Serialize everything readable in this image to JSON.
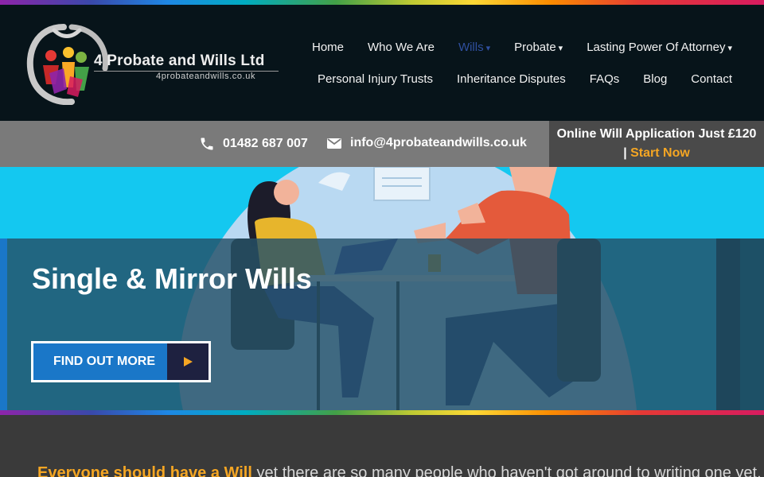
{
  "brand": {
    "name": "4 Probate and Wills Ltd",
    "url": "4probateandwills.co.uk",
    "colors": {
      "accent_orange": "#f5a623",
      "blue": "#1a77c8",
      "dark": "#07141a"
    }
  },
  "nav": {
    "row1": [
      {
        "label": "Home"
      },
      {
        "label": "Who We Are"
      },
      {
        "label": "Wills",
        "caret": "▾",
        "active": true
      },
      {
        "label": "Probate",
        "caret": "▾"
      },
      {
        "label": "Lasting Power Of Attorney",
        "caret": "▾"
      }
    ],
    "row2": [
      {
        "label": "Personal Injury Trusts"
      },
      {
        "label": "Inheritance Disputes"
      },
      {
        "label": "FAQs"
      },
      {
        "label": "Blog"
      },
      {
        "label": "Contact"
      }
    ]
  },
  "contact": {
    "phone": "01482 687 007",
    "phone_icon": "phone-icon",
    "email": "info@4probateandwills.co.uk",
    "email_icon": "envelope-icon"
  },
  "promo": {
    "text": "Online Will  Application Just £120",
    "separator": "|",
    "link": "Start Now"
  },
  "hero": {
    "title": "Single & Mirror Wills",
    "cta_label": "FIND OUT MORE",
    "cta_icon": "play-arrow-icon"
  },
  "intro": {
    "highlight": "Everyone should have a Will",
    "text": " yet there are so many people who haven't got around to writing one yet."
  }
}
